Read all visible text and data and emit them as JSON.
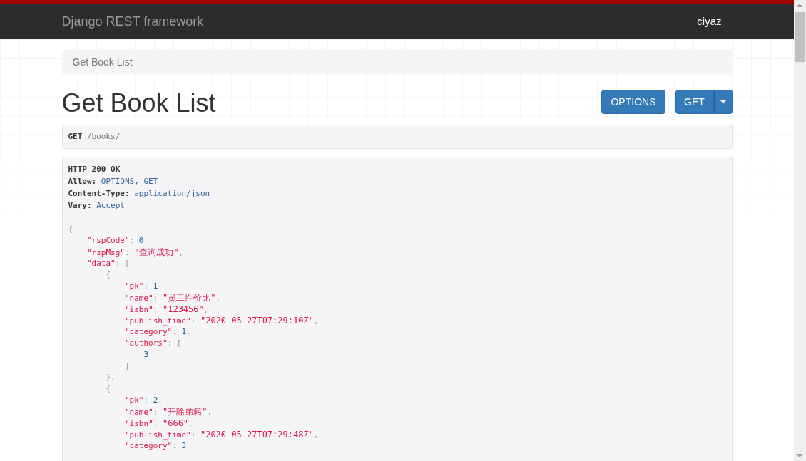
{
  "navbar": {
    "brand": "Django REST framework",
    "user": "ciyaz"
  },
  "breadcrumb": [
    {
      "label": "Get Book List",
      "selected": true
    }
  ],
  "title": "Get Book List",
  "buttons": [
    {
      "label": "OPTIONS",
      "kind": "plain"
    },
    {
      "label": "GET",
      "kind": "split"
    }
  ],
  "request": {
    "method": "GET",
    "path": "/books/"
  },
  "response": {
    "status": "HTTP 200 OK",
    "headers": [
      {
        "name": "Allow:",
        "value": "OPTIONS, GET"
      },
      {
        "name": "Content-Type:",
        "value": "application/json"
      },
      {
        "name": "Vary:",
        "value": "Accept"
      }
    ],
    "body_lines": [
      [
        {
          "kind": "punct",
          "text": "{"
        }
      ],
      [
        {
          "kind": "key",
          "text": "    \"rspCode\""
        },
        {
          "kind": "punct",
          "text": ": "
        },
        {
          "kind": "number",
          "text": "0"
        },
        {
          "kind": "punct",
          "text": ","
        }
      ],
      [
        {
          "kind": "key",
          "text": "    \"rspMsg\""
        },
        {
          "kind": "punct",
          "text": ": "
        },
        {
          "kind": "string",
          "text": "\"查询成功\""
        },
        {
          "kind": "punct",
          "text": ","
        }
      ],
      [
        {
          "kind": "key",
          "text": "    \"data\""
        },
        {
          "kind": "punct",
          "text": ": ["
        }
      ],
      [
        {
          "kind": "punct",
          "text": "        {"
        }
      ],
      [
        {
          "kind": "key",
          "text": "            \"pk\""
        },
        {
          "kind": "punct",
          "text": ": "
        },
        {
          "kind": "number",
          "text": "1"
        },
        {
          "kind": "punct",
          "text": ","
        }
      ],
      [
        {
          "kind": "key",
          "text": "            \"name\""
        },
        {
          "kind": "punct",
          "text": ": "
        },
        {
          "kind": "string",
          "text": "\"员工性价比\""
        },
        {
          "kind": "punct",
          "text": ","
        }
      ],
      [
        {
          "kind": "key",
          "text": "            \"isbn\""
        },
        {
          "kind": "punct",
          "text": ": "
        },
        {
          "kind": "string",
          "text": "\"123456\""
        },
        {
          "kind": "punct",
          "text": ","
        }
      ],
      [
        {
          "kind": "key",
          "text": "            \"publish_time\""
        },
        {
          "kind": "punct",
          "text": ": "
        },
        {
          "kind": "string",
          "text": "\"2020-05-27T07:29:10Z\""
        },
        {
          "kind": "punct",
          "text": ","
        }
      ],
      [
        {
          "kind": "key",
          "text": "            \"category\""
        },
        {
          "kind": "punct",
          "text": ": "
        },
        {
          "kind": "number",
          "text": "1"
        },
        {
          "kind": "punct",
          "text": ","
        }
      ],
      [
        {
          "kind": "key",
          "text": "            \"authors\""
        },
        {
          "kind": "punct",
          "text": ": ["
        }
      ],
      [
        {
          "kind": "number",
          "text": "                3"
        }
      ],
      [
        {
          "kind": "punct",
          "text": "            ]"
        }
      ],
      [
        {
          "kind": "punct",
          "text": "        },"
        }
      ],
      [
        {
          "kind": "punct",
          "text": "        {"
        }
      ],
      [
        {
          "kind": "key",
          "text": "            \"pk\""
        },
        {
          "kind": "punct",
          "text": ": "
        },
        {
          "kind": "number",
          "text": "2"
        },
        {
          "kind": "punct",
          "text": ","
        }
      ],
      [
        {
          "kind": "key",
          "text": "            \"name\""
        },
        {
          "kind": "punct",
          "text": ": "
        },
        {
          "kind": "string",
          "text": "\"开除弟籍\""
        },
        {
          "kind": "punct",
          "text": ","
        }
      ],
      [
        {
          "kind": "key",
          "text": "            \"isbn\""
        },
        {
          "kind": "punct",
          "text": ": "
        },
        {
          "kind": "string",
          "text": "\"666\""
        },
        {
          "kind": "punct",
          "text": ","
        }
      ],
      [
        {
          "kind": "key",
          "text": "            \"publish_time\""
        },
        {
          "kind": "punct",
          "text": ": "
        },
        {
          "kind": "string",
          "text": "\"2020-05-27T07:29:48Z\""
        },
        {
          "kind": "punct",
          "text": ","
        }
      ],
      [
        {
          "kind": "key",
          "text": "            \"category\""
        },
        {
          "kind": "punct",
          "text": ": "
        },
        {
          "kind": "number",
          "text": "3"
        }
      ]
    ]
  }
}
